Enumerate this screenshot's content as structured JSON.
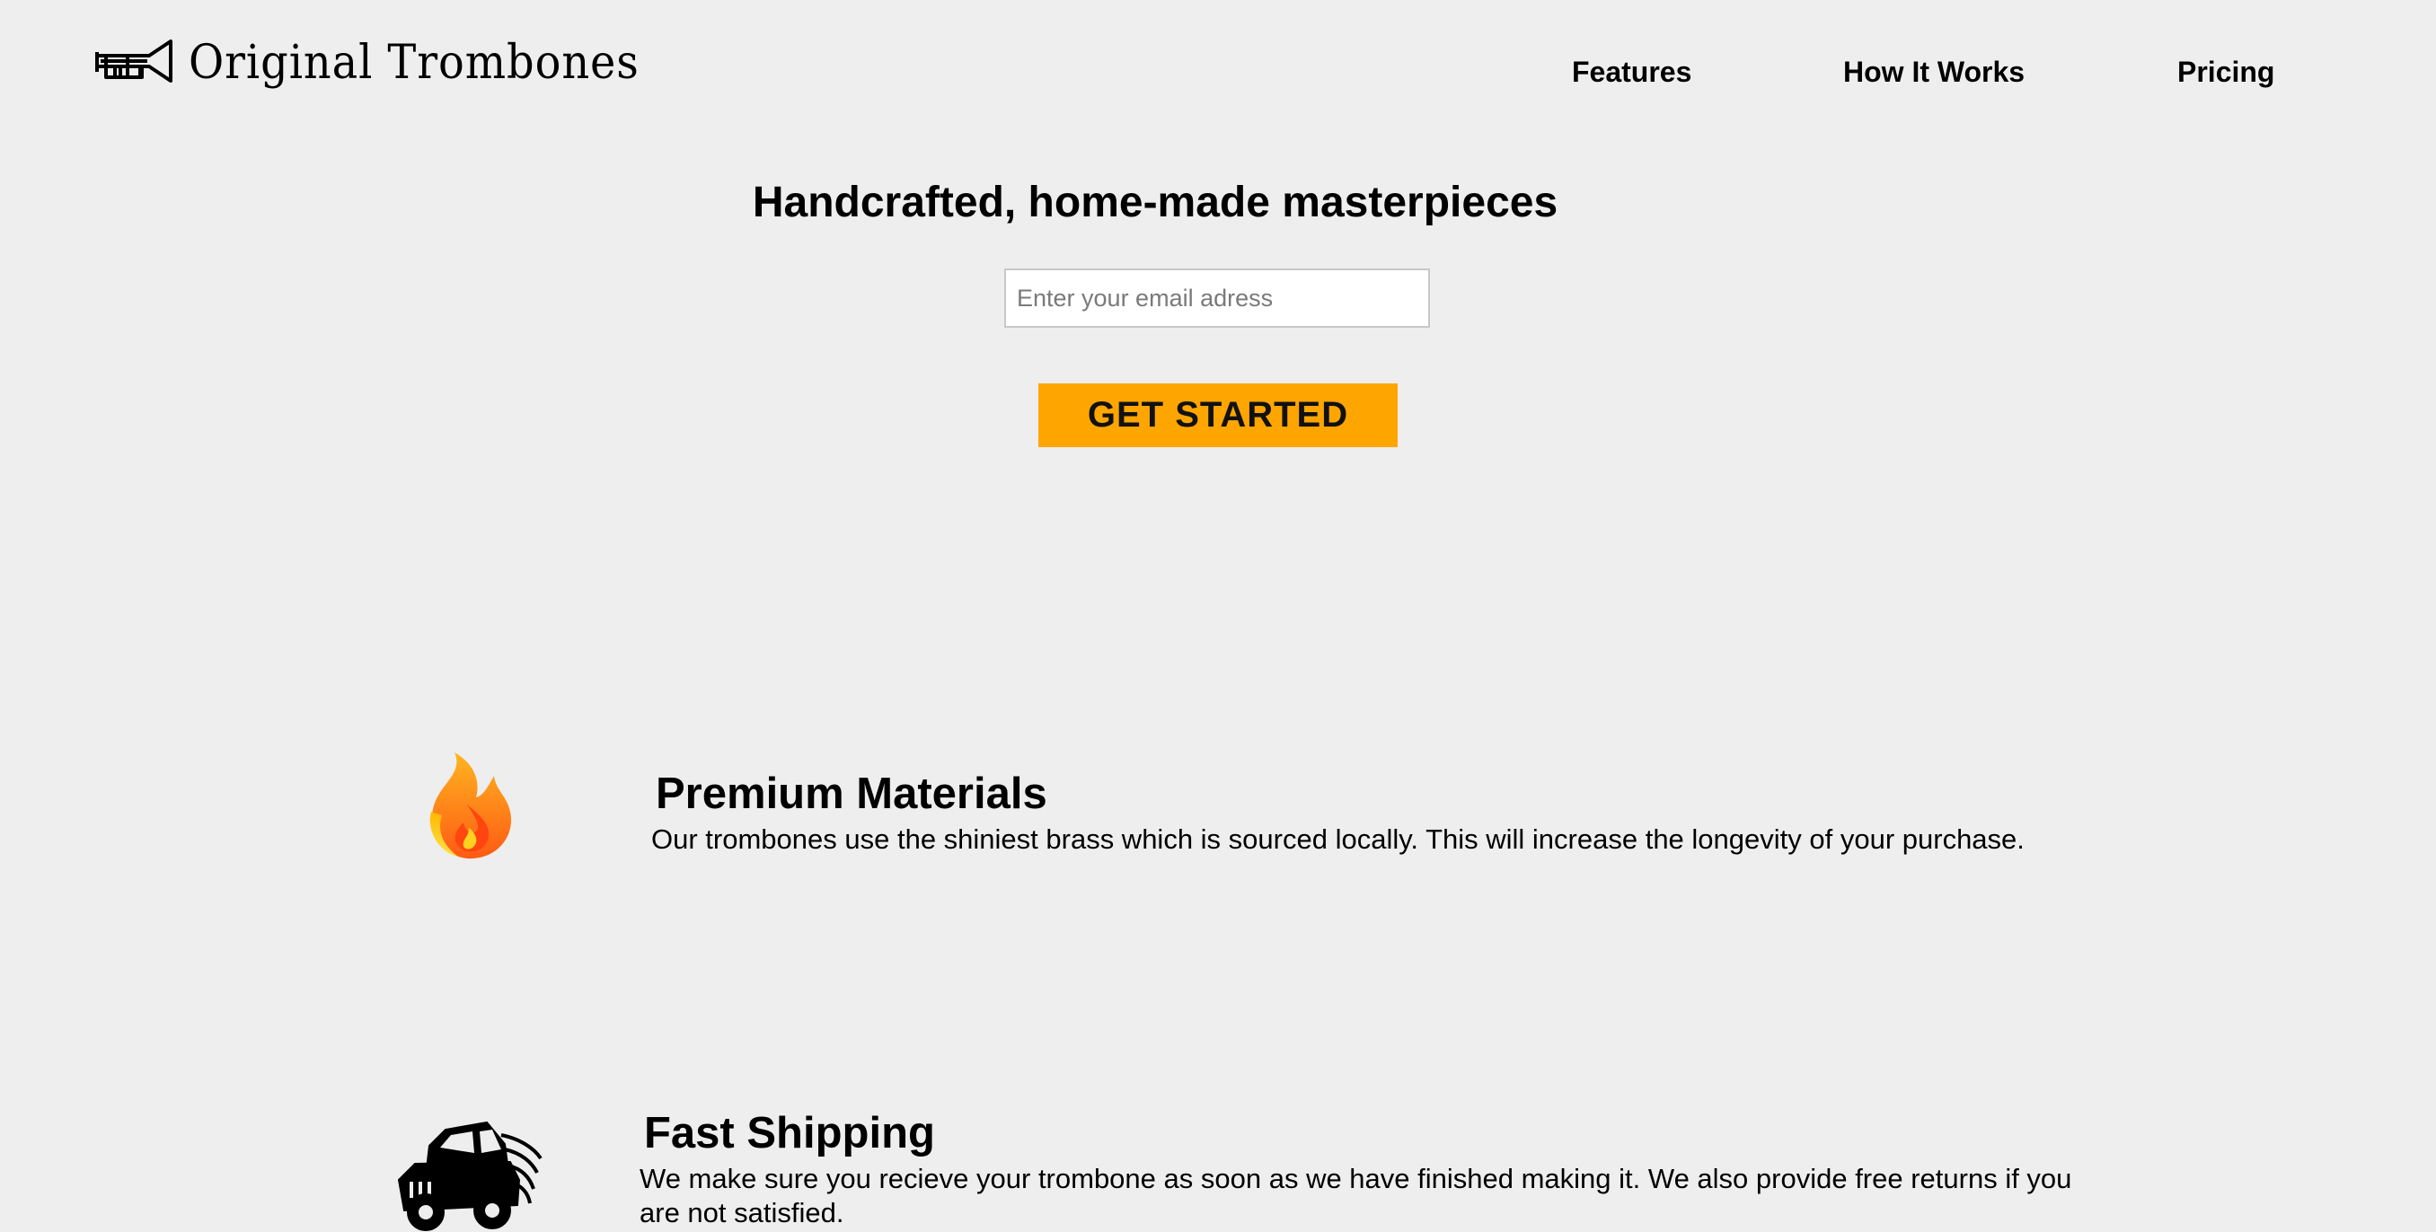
{
  "header": {
    "logo_text": "Original Trombones",
    "nav": {
      "features": "Features",
      "how_it_works": "How It Works",
      "pricing": "Pricing"
    }
  },
  "hero": {
    "title": "Handcrafted, home-made masterpieces",
    "email_placeholder": "Enter your email adress",
    "cta_label": "GET STARTED"
  },
  "features": [
    {
      "icon": "fire-icon",
      "title": "Premium Materials",
      "description": "Our trombones use the shiniest brass which is sourced locally. This will increase the longevity of your purchase."
    },
    {
      "icon": "jeep-icon",
      "title": "Fast Shipping",
      "description": "We make sure you recieve your trombone as soon as we have finished making it. We also provide free returns if you are not satisfied."
    }
  ],
  "colors": {
    "background": "#eeeeee",
    "cta_background": "#ffa500"
  }
}
